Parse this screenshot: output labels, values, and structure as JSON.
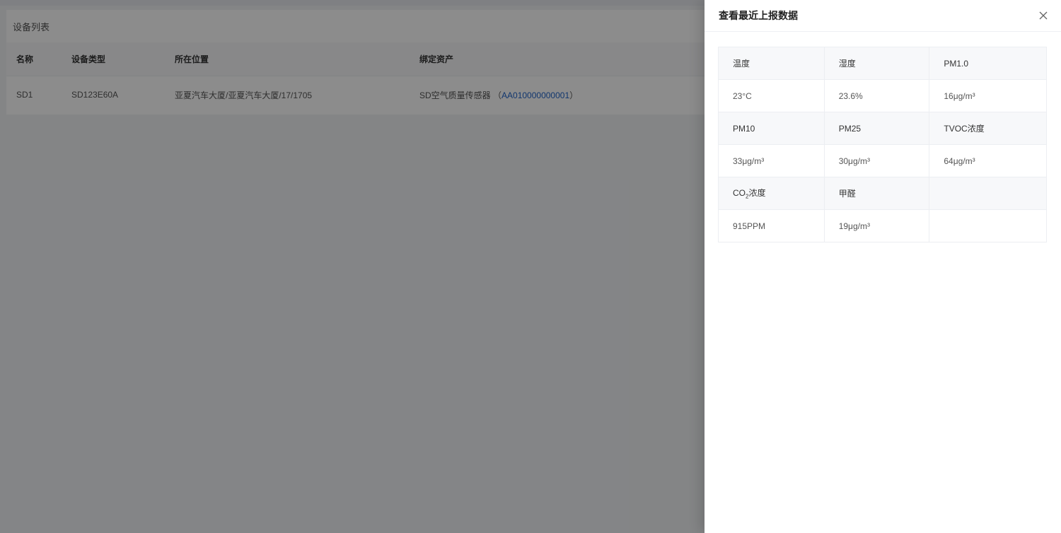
{
  "page": {
    "card_title": "设备列表",
    "columns": [
      "名称",
      "设备类型",
      "所在位置",
      "绑定资产"
    ],
    "rows": [
      {
        "name": "SD1",
        "type": "SD123E60A",
        "location": "亚夏汽车大厦/亚夏汽车大厦/17/1705",
        "asset_name": "SD空气质量传感器",
        "asset_open": "（",
        "asset_code": "AA010000000001",
        "asset_close": "）"
      }
    ]
  },
  "drawer": {
    "title": "查看最近上报数据",
    "close_icon": "close-icon",
    "labels": {
      "temperature": "温度",
      "humidity": "湿度",
      "pm1": "PM1.0",
      "pm10": "PM10",
      "pm25": "PM25",
      "tvoc": "TVOC浓度",
      "co2_prefix": "CO",
      "co2_sub": "2",
      "co2_suffix": "浓度",
      "hcho": "甲醛"
    },
    "values": {
      "temperature": "23°C",
      "humidity": "23.6%",
      "pm1": "16μg/m³",
      "pm10": "33μg/m³",
      "pm25": "30μg/m³",
      "tvoc": "64μg/m³",
      "co2": "915PPM",
      "hcho": "19μg/m³"
    }
  },
  "colors": {
    "mask": "rgba(0,0,0,0.45)",
    "link": "#1f63c8",
    "label_bg": "#f7f8fa"
  }
}
